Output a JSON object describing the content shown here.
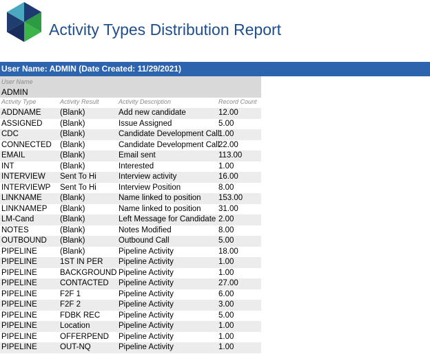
{
  "header": {
    "title": "Activity Types Distribution Report"
  },
  "user_bar": {
    "text": "User Name: ADMIN (Date Created: 11/29/2021)"
  },
  "user_group": {
    "label": "User Name",
    "value": "ADMIN"
  },
  "columns": {
    "activity_type": "Activity Type",
    "activity_result": "Activity Result",
    "activity_description": "Activity Description",
    "record_count": "Record Count"
  },
  "rows": [
    {
      "type": "ADDNAME",
      "result": "(Blank)",
      "description": "Add new candidate",
      "count": "12.00"
    },
    {
      "type": "ASSIGNED",
      "result": "(Blank)",
      "description": "Issue Assigned",
      "count": "5.00"
    },
    {
      "type": "CDC",
      "result": "(Blank)",
      "description": "Candidate Development Call",
      "count": "1.00"
    },
    {
      "type": "CONNECTED",
      "result": "(Blank)",
      "description": "Candidate Development Call",
      "count": "22.00"
    },
    {
      "type": "EMAIL",
      "result": "(Blank)",
      "description": "Email sent",
      "count": "113.00"
    },
    {
      "type": "INT",
      "result": "(Blank)",
      "description": "Interested",
      "count": "1.00"
    },
    {
      "type": "INTERVIEW",
      "result": "Sent To Hi",
      "description": "Interview activity",
      "count": "16.00"
    },
    {
      "type": "INTERVIEWP",
      "result": "Sent To Hi",
      "description": "Interview Position",
      "count": "8.00"
    },
    {
      "type": "LINKNAME",
      "result": "(Blank)",
      "description": "Name linked to position",
      "count": "153.00"
    },
    {
      "type": "LINKNAMEP",
      "result": "(Blank)",
      "description": "Name linked to position",
      "count": "31.00"
    },
    {
      "type": "LM-Cand",
      "result": "(Blank)",
      "description": "Left Message for Candidate",
      "count": "2.00"
    },
    {
      "type": "NOTES",
      "result": "(Blank)",
      "description": "Notes Modified",
      "count": "8.00"
    },
    {
      "type": "OUTBOUND",
      "result": "(Blank)",
      "description": "Outbound Call",
      "count": "5.00"
    },
    {
      "type": "PIPELINE",
      "result": "(Blank)",
      "description": "Pipeline Activity",
      "count": "18.00"
    },
    {
      "type": "PIPELINE",
      "result": "1ST IN PER",
      "description": "Pipeline Activity",
      "count": "1.00"
    },
    {
      "type": "PIPELINE",
      "result": "BACKGROUND",
      "description": "Pipeline Activity",
      "count": "1.00"
    },
    {
      "type": "PIPELINE",
      "result": "CONTACTED",
      "description": "Pipeline Activity",
      "count": "27.00"
    },
    {
      "type": "PIPELINE",
      "result": "F2F 1",
      "description": "Pipeline Activity",
      "count": "6.00"
    },
    {
      "type": "PIPELINE",
      "result": "F2F 2",
      "description": "Pipeline Activity",
      "count": "3.00"
    },
    {
      "type": "PIPELINE",
      "result": "FDBK REC",
      "description": "Pipeline Activity",
      "count": "5.00"
    },
    {
      "type": "PIPELINE",
      "result": "Location",
      "description": "Pipeline Activity",
      "count": "1.00"
    },
    {
      "type": "PIPELINE",
      "result": "OFFERPEND",
      "description": "Pipeline Activity",
      "count": "1.00"
    },
    {
      "type": "PIPELINE",
      "result": "OUT-NQ",
      "description": "Pipeline Activity",
      "count": "1.00"
    }
  ],
  "colors": {
    "title": "#1f4e8c",
    "bar": "#2e63ae",
    "group_bg": "#d9d9d9",
    "alt_row": "#ececec"
  }
}
